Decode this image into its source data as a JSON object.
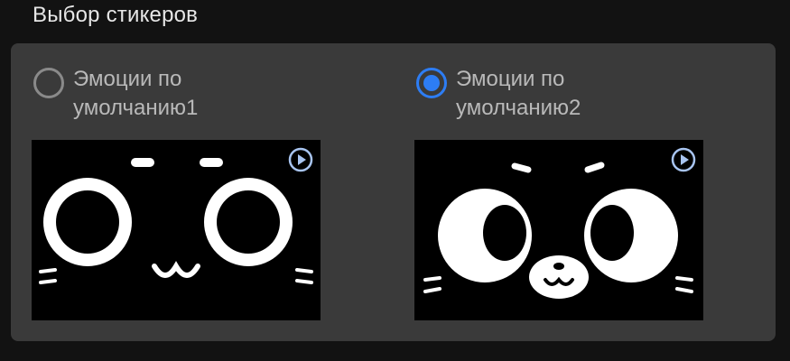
{
  "section": {
    "title": "Выбор стикеров"
  },
  "options": [
    {
      "label": "Эмоции по\nумолчанию1",
      "selected": false
    },
    {
      "label": "Эмоции по\nумолчанию2",
      "selected": true
    }
  ],
  "colors": {
    "accent": "#2d7df4",
    "panel": "#3a3a3a",
    "background": "#121212",
    "play_icon": "#a8c4f0"
  },
  "icons": {
    "play": "play-circle-icon"
  }
}
